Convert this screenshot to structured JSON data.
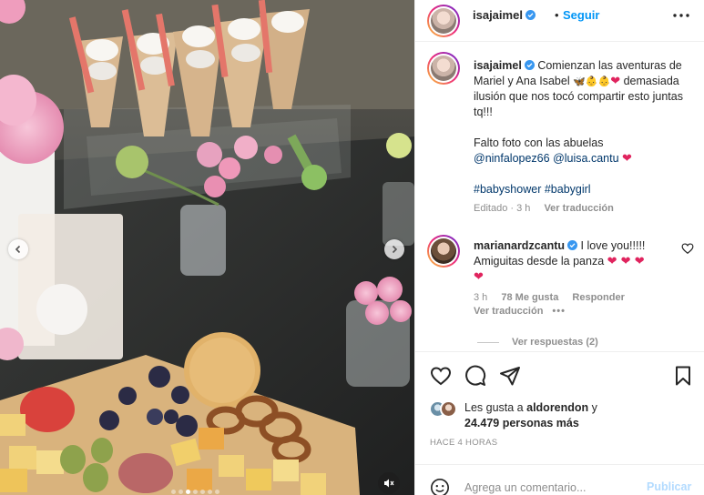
{
  "post": {
    "username": "isajaimel",
    "follow_dot": "•",
    "follow_label": "Seguir",
    "more_icon": "more-horizontal-icon"
  },
  "caption": {
    "username": "isajaimel",
    "line1": "Comienzan las aventuras de Mariel y Ana Isabel",
    "emojis1": "🦋👶👶",
    "line1b": "demasiada ilusión que nos tocó compartir esto juntas tq!!!",
    "line2": "Falto foto con las abuelas",
    "mention1": "@ninfalopez66",
    "mention2": "@luisa.cantu",
    "heart": "❤",
    "hashtag1": "#babyshower",
    "hashtag2": "#babygirl",
    "edited": "Editado",
    "time": "3 h",
    "translate": "Ver traducción"
  },
  "comment": {
    "username": "marianardzcantu",
    "text1": "I love you!!!!!",
    "text2": "Amiguitas desde la panza",
    "hearts": "❤ ❤ ❤",
    "heart_last": "❤",
    "time": "3 h",
    "likes": "78 Me gusta",
    "reply": "Responder",
    "translate": "Ver traducción",
    "more": "•••",
    "view_replies": "Ver respuestas (2)"
  },
  "likes": {
    "prefix": "Les gusta a",
    "user": "aldorendon",
    "conj": "y",
    "count": "24.479 personas más"
  },
  "posted_ago": "HACE 4 HORAS",
  "add_comment": {
    "placeholder": "Agrega un comentario...",
    "publish_label": "Publicar"
  },
  "colors": {
    "accent": "#0095f6",
    "publish_disabled": "#b3dbff",
    "heart": "#e0245e",
    "secondary_text": "#8e8e8e"
  },
  "carousel": {
    "dots_total": 7,
    "active_index": 2
  }
}
